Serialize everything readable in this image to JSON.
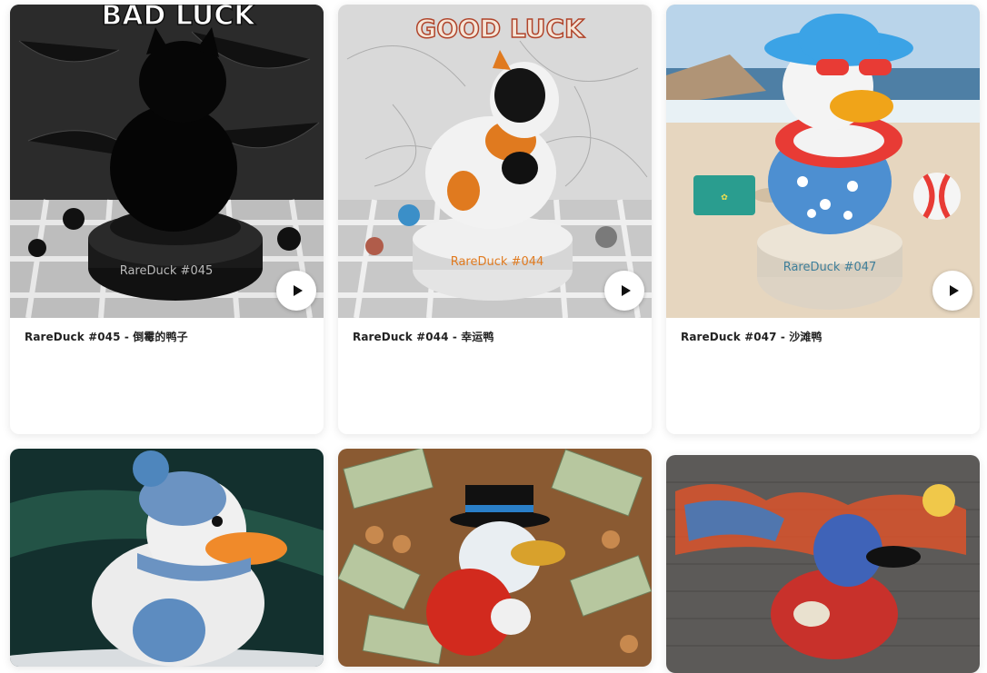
{
  "cards": [
    {
      "title": "RareDuck #045 - 倒霉的鸭子",
      "sign": "BAD LUCK",
      "plaque": "RareDuck #045"
    },
    {
      "title": "RareDuck #044 - 幸运鸭",
      "sign": "GOOD LUCK",
      "plaque": "RareDuck #044"
    },
    {
      "title": "RareDuck #047 - 沙滩鸭",
      "sign": "",
      "plaque": "RareDuck #047"
    },
    {
      "title": "",
      "sign": "",
      "plaque": ""
    },
    {
      "title": "",
      "sign": "",
      "plaque": ""
    },
    {
      "title": "",
      "sign": "",
      "plaque": ""
    }
  ],
  "icons": {
    "play": "play-icon"
  },
  "colors": {
    "card_bg": "#ffffff",
    "title": "#222222",
    "page_bg": "#ffffff"
  }
}
